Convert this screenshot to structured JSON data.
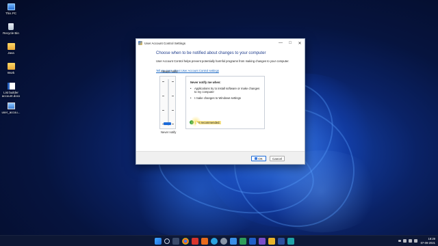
{
  "desktop": {
    "icons": [
      {
        "label": "This PC",
        "icon": "computer-icon"
      },
      {
        "label": "Recycle Bin",
        "icon": "recycle-bin-icon"
      },
      {
        "label": "Java",
        "icon": "folder-icon"
      },
      {
        "label": "Work",
        "icon": "folder-icon"
      },
      {
        "label": "List builder account.docx",
        "icon": "word-document-icon"
      },
      {
        "label": "user_accou...",
        "icon": "image-file-icon"
      }
    ]
  },
  "dialog": {
    "title": "User Account Control Settings",
    "heading": "Choose when to be notified about changes to your computer",
    "description": "User Account Control helps prevent potentially harmful programs from making changes to your computer.",
    "link": "Tell me more about User Account Control settings",
    "slider": {
      "top_label": "Always notify",
      "bottom_label": "Never notify",
      "levels": 4,
      "selected_level": 1
    },
    "info": {
      "heading": "Never notify me when:",
      "bullets": [
        "Applications try to install software or make changes to my computer",
        "I make changes to Windows settings"
      ],
      "warning": "Not recommended."
    },
    "buttons": {
      "ok": "OK",
      "cancel": "Cancel"
    }
  },
  "taskbar": {
    "apps": [
      "start-icon",
      "search-icon",
      "task-view-icon",
      "chrome-icon",
      "app-red-icon",
      "app-orange-icon",
      "telegram-icon",
      "settings-icon",
      "photos-icon",
      "app-green-icon",
      "app-blue-icon",
      "app-purple-icon",
      "app-yellow-icon",
      "app-darkblue-icon",
      "app-teal-icon"
    ],
    "time": "19:29",
    "date": "07-09-2021"
  },
  "colors": {
    "accent": "#1b6ad8",
    "heading": "#1e3c8c",
    "link": "#1866c2",
    "warning_highlight": "#f7e38a"
  }
}
